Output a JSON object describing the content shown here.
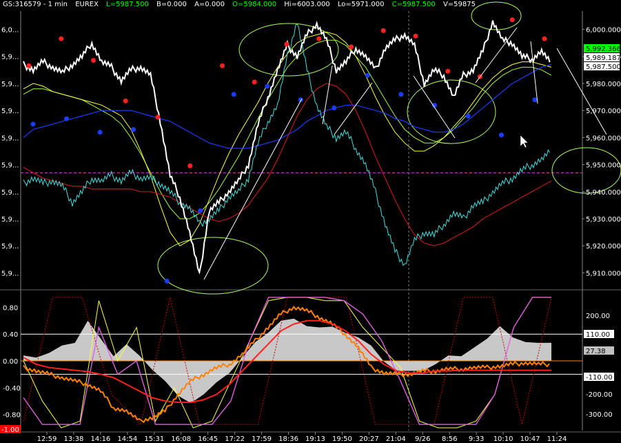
{
  "header": {
    "symbol": "GS:316579 - 1 min",
    "exchange": "EUREX",
    "last": "L=5987.500",
    "bid": "B=0.000",
    "ask": "A=0.000",
    "open": "O=5984.000",
    "high": "Hi=6003.000",
    "low": "Lo=5971.000",
    "close": "C=5987.500",
    "volume": "V=59875"
  },
  "colors": {
    "background": "#000000",
    "price": "#ffffff",
    "cyan": "#40e0e0",
    "blue_ma": "#1a3cff",
    "red_ma": "#c01818",
    "yellow": "#ffff40",
    "green": "#a0ff40",
    "magenta_dash": "#cc44cc",
    "peak_dot": "#ff2020",
    "trough_dot": "#1a3cff",
    "histogram": "#c8c8c8",
    "label_green_bg": "#00ff00",
    "grid_dotted": "#c80000"
  },
  "chart_data": [
    {
      "type": "line",
      "panel": "price",
      "y_right_ticks": [
        "6,000.000",
        "5,990.000",
        "5,980.000",
        "5,970.000",
        "5,960.000",
        "5,950.000",
        "5,940.000",
        "5,930.000",
        "5,920.000",
        "5,910.000"
      ],
      "y_left_ticks": [
        "6,0...",
        "5,9...",
        "5,9...",
        "5,9...",
        "5,9...",
        "5,9...",
        "5,9...",
        "5,9...",
        "5,9...",
        "5,9..."
      ],
      "ylim": [
        5905,
        6006
      ],
      "price_labels": [
        "5,992.366",
        "5,989.187",
        "5,987.500"
      ],
      "series": [
        {
          "key": "price",
          "values": [
            5987,
            5985,
            5988,
            5986,
            5984,
            5987,
            5990,
            5995,
            5988,
            5986,
            5981,
            5985,
            5986,
            5983,
            5966,
            5946,
            5938,
            5925,
            5909,
            5933,
            5936,
            5940,
            5944,
            5950,
            5965,
            5975,
            5985,
            5994,
            5990,
            5998,
            6002,
            5996,
            5985,
            5988,
            5993,
            5990,
            5985,
            5993,
            5996,
            5998,
            5994,
            5980,
            5985,
            5983,
            5975,
            5983,
            5985,
            5992,
            6003,
            5996,
            5995,
            5990,
            5989,
            5992,
            5987
          ]
        },
        {
          "key": "cyan",
          "values": [
            5943,
            5945,
            5943,
            5944,
            5942,
            5936,
            5940,
            5945,
            5944,
            5946,
            5944,
            5947,
            5945,
            5945,
            5943,
            5940,
            5936,
            5934,
            5928,
            5930,
            5933,
            5938,
            5940,
            5945,
            5958,
            5966,
            5972,
            5990,
            6003,
            5985,
            5972,
            5964,
            5960,
            5962,
            5956,
            5950,
            5940,
            5928,
            5918,
            5913,
            5922,
            5925,
            5924,
            5928,
            5932,
            5930,
            5935,
            5936,
            5940,
            5943,
            5945,
            5948,
            5950,
            5952,
            5955
          ]
        },
        {
          "key": "blue_ma",
          "values": [
            5960,
            5963,
            5964,
            5965,
            5966,
            5967,
            5968,
            5969,
            5970,
            5970,
            5970,
            5970,
            5969,
            5968,
            5967,
            5966,
            5964,
            5962,
            5960,
            5958,
            5957,
            5956,
            5956,
            5956,
            5957,
            5958,
            5959,
            5961,
            5963,
            5966,
            5968,
            5970,
            5971,
            5972,
            5972,
            5971,
            5970,
            5969,
            5967,
            5966,
            5964,
            5963,
            5962,
            5962,
            5963,
            5965,
            5968,
            5971,
            5974,
            5977,
            5980,
            5982,
            5984,
            5986,
            5987
          ]
        },
        {
          "key": "red_ma",
          "values": [
            5949,
            5947,
            5945,
            5944,
            5943,
            5942,
            5942,
            5941,
            5941,
            5941,
            5941,
            5941,
            5940,
            5940,
            5939,
            5938,
            5936,
            5934,
            5932,
            5930,
            5929,
            5930,
            5932,
            5935,
            5940,
            5945,
            5952,
            5960,
            5968,
            5974,
            5978,
            5980,
            5979,
            5976,
            5970,
            5962,
            5953,
            5945,
            5937,
            5930,
            5924,
            5921,
            5920,
            5921,
            5923,
            5925,
            5927,
            5930,
            5932,
            5934,
            5936,
            5938,
            5940,
            5942,
            5944
          ]
        },
        {
          "key": "yellow",
          "values": [
            5978,
            5980,
            5979,
            5977,
            5976,
            5975,
            5974,
            5973,
            5972,
            5970,
            5968,
            5963,
            5955,
            5946,
            5935,
            5925,
            5920,
            5922,
            5928,
            5937,
            5946,
            5954,
            5961,
            5967,
            5973,
            5980,
            5986,
            5991,
            5995,
            5997,
            5998,
            5999,
            5998,
            5995,
            5990,
            5983,
            5975,
            5968,
            5962,
            5958,
            5955,
            5955,
            5957,
            5960,
            5964,
            5968,
            5973,
            5978,
            5982,
            5985,
            5987,
            5988,
            5988,
            5987,
            5986
          ]
        },
        {
          "key": "green",
          "values": [
            5976,
            5978,
            5978,
            5977,
            5976,
            5975,
            5974,
            5972,
            5970,
            5968,
            5965,
            5960,
            5954,
            5947,
            5940,
            5934,
            5930,
            5930,
            5932,
            5936,
            5941,
            5947,
            5953,
            5960,
            5967,
            5974,
            5980,
            5986,
            5990,
            5993,
            5995,
            5996,
            5996,
            5994,
            5990,
            5986,
            5980,
            5974,
            5968,
            5963,
            5960,
            5958,
            5958,
            5960,
            5963,
            5967,
            5971,
            5976,
            5980,
            5983,
            5985,
            5986,
            5986,
            5985,
            5983
          ]
        }
      ],
      "peaks": [
        5985,
        5995,
        5987,
        5972,
        5966,
        5948,
        5985,
        5979,
        5993,
        5995,
        5992,
        5998,
        5996,
        5983,
        5981,
        6002,
        5995
      ],
      "troughs": [
        5967,
        5969,
        5964,
        5965,
        5909,
        5935,
        5978,
        5981,
        5976,
        5973,
        5985,
        5978,
        5974,
        5970,
        5963,
        5976
      ]
    },
    {
      "type": "line",
      "panel": "oscillator",
      "y_left_ticks": [
        "0.80",
        "0.40",
        "0.00",
        "-0.40",
        "-0.80",
        "-1.00"
      ],
      "y_right_ticks": [
        "200.00",
        "110.00",
        "27.38",
        "-110.00",
        "-200.00",
        "-300.00"
      ],
      "ylim_left": [
        -1.0,
        1.0
      ],
      "hlines": [
        0.4,
        0.0,
        -0.2
      ],
      "x_ticks": [
        "12:59",
        "13:38",
        "14:16",
        "14:54",
        "15:31",
        "16:08",
        "16:45",
        "17:22",
        "17:59",
        "18:36",
        "19:13",
        "19:50",
        "20:27",
        "21:04",
        "9/26",
        "8:56",
        "9:33",
        "10:10",
        "10:47",
        "11:24"
      ],
      "series": [
        {
          "key": "histogram",
          "values": [
            0.05,
            0.08,
            0.12,
            0.2,
            0.3,
            0.6,
            0.3,
            0.1,
            0.25,
            0.05,
            -0.1,
            -0.3,
            -0.55,
            -0.6,
            -0.5,
            -0.35,
            -0.15,
            0.05,
            0.25,
            0.45,
            0.6,
            0.6,
            0.55,
            0.5,
            0.48,
            0.45,
            0.35,
            0.2,
            0.02,
            -0.15,
            -0.18,
            -0.12,
            -0.05,
            0.05,
            0.1,
            0.2,
            0.3,
            0.55,
            0.35,
            0.25,
            0.3,
            0.27
          ]
        },
        {
          "key": "red_osc",
          "values": [
            0.05,
            -0.05,
            -0.1,
            -0.12,
            -0.14,
            -0.16,
            -0.2,
            -0.25,
            -0.35,
            -0.45,
            -0.55,
            -0.6,
            -0.62,
            -0.62,
            -0.58,
            -0.5,
            -0.35,
            -0.15,
            0.05,
            0.25,
            0.45,
            0.55,
            0.6,
            0.6,
            0.55,
            0.45,
            0.3,
            0.1,
            -0.05,
            -0.15,
            -0.18,
            -0.18,
            -0.15,
            -0.15,
            -0.14,
            -0.14,
            -0.14,
            -0.14,
            -0.14,
            -0.14,
            -0.14,
            -0.14
          ]
        },
        {
          "key": "orange_osc",
          "values": [
            -0.1,
            -0.15,
            -0.2,
            -0.25,
            -0.3,
            -0.35,
            -0.45,
            -0.7,
            -0.75,
            -0.9,
            -0.85,
            -0.75,
            -0.5,
            -0.3,
            -0.2,
            -0.1,
            -0.05,
            0.1,
            0.3,
            0.5,
            0.7,
            0.8,
            0.75,
            0.65,
            0.55,
            0.4,
            0.2,
            -0.1,
            -0.18,
            -0.2,
            -0.2,
            -0.15,
            -0.15,
            -0.12,
            -0.12,
            -0.1,
            -0.1,
            -0.08,
            -0.05,
            -0.03,
            -0.05,
            -0.05
          ]
        },
        {
          "key": "yellow_osc",
          "values": [
            0.0,
            -0.6,
            -1.0,
            -0.9,
            0.9,
            0.0,
            0.5,
            -0.9,
            -0.4,
            -1.0,
            -0.9,
            -0.3,
            0.3,
            0.9,
            0.95,
            0.95,
            0.9,
            0.9,
            0.5,
            0.2,
            -0.1,
            -0.9,
            -1.0,
            -1.0,
            -0.9,
            -0.5,
            0.5,
            0.95,
            0.95
          ]
        },
        {
          "key": "magenta_osc",
          "values": [
            -0.55,
            -0.95,
            -0.95,
            -0.95,
            0.5,
            -0.2,
            0.0,
            -0.95,
            -0.95,
            -0.95,
            -0.95,
            -0.6,
            0.3,
            0.95,
            0.95,
            0.95,
            0.95,
            0.9,
            0.7,
            0.3,
            -0.3,
            -0.95,
            -0.95,
            -0.95,
            -0.95,
            -0.5,
            0.5,
            0.95,
            0.95
          ]
        },
        {
          "key": "dotted_red",
          "values": [
            -0.9,
            0.95,
            0.95,
            -0.5,
            -0.95,
            0.95,
            -0.95,
            -0.95,
            -0.95,
            0.95,
            0.95,
            0.95,
            -0.95,
            -0.95,
            -0.95,
            0.95,
            0.95,
            -0.95,
            0.95
          ]
        }
      ]
    }
  ]
}
